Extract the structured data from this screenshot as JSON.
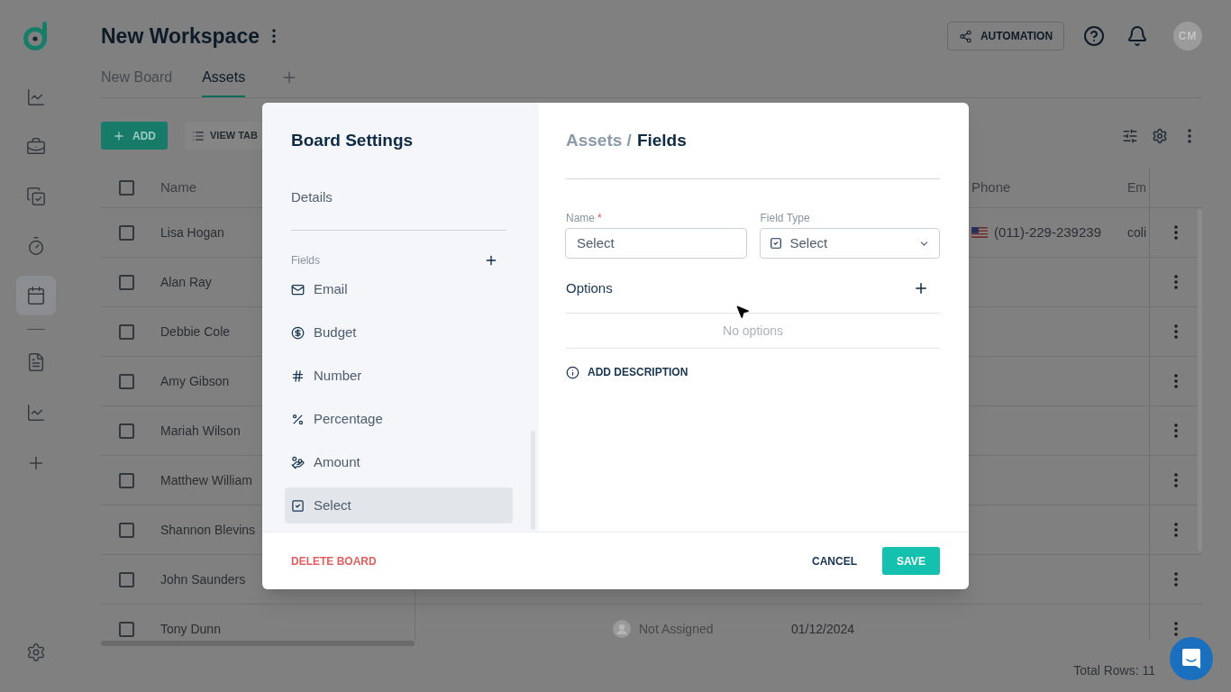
{
  "sidebar": {
    "main_items": [
      {
        "kind": "chart",
        "selected": false
      },
      {
        "kind": "briefcase",
        "selected": false
      },
      {
        "kind": "tasks",
        "selected": false
      },
      {
        "kind": "timer",
        "selected": false
      },
      {
        "kind": "calendar",
        "selected": true
      }
    ],
    "extra_items": [
      {
        "kind": "document",
        "selected": false
      },
      {
        "kind": "chart",
        "selected": false
      },
      {
        "kind": "add",
        "selected": false
      }
    ]
  },
  "header": {
    "title": "New Workspace",
    "automation_button": "AUTOMATION",
    "avatar_initials": "CM"
  },
  "tabs": [
    {
      "label": "New Board",
      "selected": false
    },
    {
      "label": "Assets",
      "selected": true
    }
  ],
  "toolbar": {
    "add_button": "ADD",
    "view_button": "VIEW TAB"
  },
  "table": {
    "select_all_checked": false,
    "columns": [
      {
        "label": "Name"
      },
      {
        "label": "Phone"
      },
      {
        "label": "Em"
      }
    ],
    "rows": [
      {
        "name": "Lisa Hogan",
        "checked": false,
        "phone": "(011)-229-239239",
        "email": "coli"
      },
      {
        "name": "Alan Ray",
        "checked": false
      },
      {
        "name": "Debbie Cole",
        "checked": false
      },
      {
        "name": "Amy Gibson",
        "checked": false
      },
      {
        "name": "Mariah Wilson",
        "checked": false
      },
      {
        "name": "Matthew William",
        "checked": false
      },
      {
        "name": "Shannon Blevins",
        "checked": false
      },
      {
        "name": "John Saunders",
        "checked": false
      },
      {
        "name": "Tony Dunn",
        "checked": false,
        "assignee": "Not Assigned",
        "date": "01/12/2024"
      }
    ]
  },
  "footer": {
    "total_rows": "Total Rows: 11"
  },
  "dialog": {
    "title": "Board Settings",
    "details_link": "Details",
    "fields_heading": "Fields",
    "fields": [
      {
        "kind": "email",
        "label": "Email",
        "selected": false
      },
      {
        "kind": "budget",
        "label": "Budget",
        "selected": false
      },
      {
        "kind": "number",
        "label": "Number",
        "selected": false
      },
      {
        "kind": "percentage",
        "label": "Percentage",
        "selected": false
      },
      {
        "kind": "amount",
        "label": "Amount",
        "selected": false
      },
      {
        "kind": "select",
        "label": "Select",
        "selected": true
      }
    ],
    "breadcrumb": {
      "parent": "Assets /",
      "current": "Fields"
    },
    "name_field": {
      "label": "Name",
      "required_mark": "*",
      "value": "Select"
    },
    "type_field": {
      "label": "Field Type",
      "kind": "select",
      "value": "Select"
    },
    "options": {
      "heading": "Options",
      "empty_text": "No options"
    },
    "add_description": "ADD DESCRIPTION",
    "delete_button": "DELETE BOARD",
    "cancel_button": "CANCEL",
    "save_button": "SAVE"
  }
}
